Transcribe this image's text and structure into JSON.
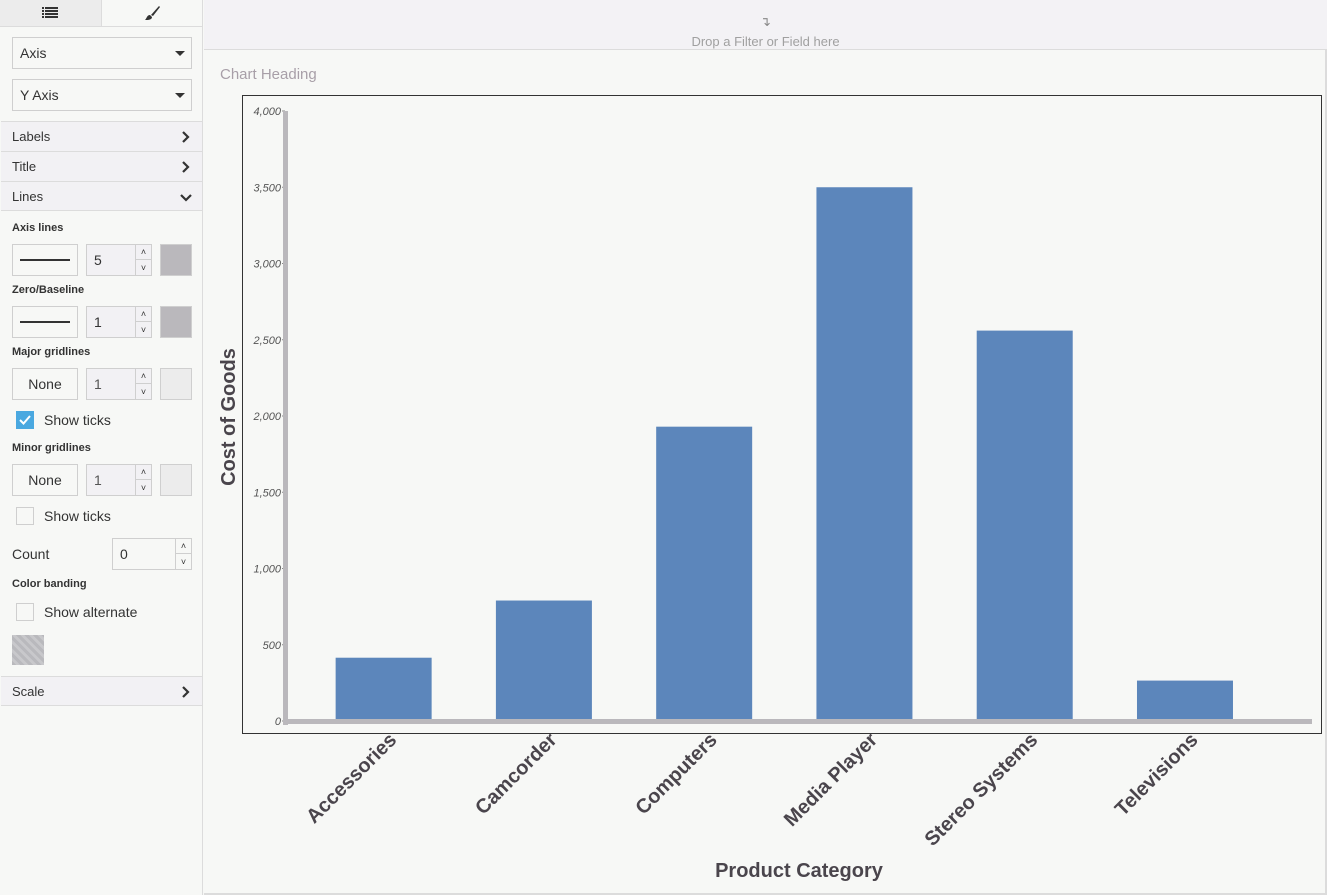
{
  "sidebar": {
    "tabs": [
      {
        "name": "fields",
        "icon": "list-icon"
      },
      {
        "name": "format",
        "icon": "paintbrush-icon",
        "active": true
      }
    ],
    "element_select": "Axis",
    "axis_select": "Y Axis",
    "sections": {
      "labels": "Labels",
      "title": "Title",
      "lines": "Lines",
      "scale": "Scale"
    },
    "lines": {
      "axis_lines": {
        "label": "Axis lines",
        "style": "solid",
        "width": "5",
        "color": "#bab8bc"
      },
      "zero_baseline": {
        "label": "Zero/Baseline",
        "style": "solid",
        "width": "1",
        "color": "#bab8bc"
      },
      "major_gridlines": {
        "label": "Major gridlines",
        "style": "None",
        "width": "1",
        "color": "#ececec",
        "show_ticks_label": "Show ticks",
        "show_ticks": true
      },
      "minor_gridlines": {
        "label": "Minor gridlines",
        "style": "None",
        "width": "1",
        "color": "#ececec",
        "show_ticks_label": "Show ticks",
        "show_ticks": false
      },
      "count": {
        "label": "Count",
        "value": "0"
      },
      "color_banding": {
        "label": "Color banding",
        "show_alternate_label": "Show alternate",
        "show_alternate": false
      }
    }
  },
  "dropzone": {
    "icon": "drop-arrow-icon",
    "text": "Drop a Filter or Field here"
  },
  "chart_heading": "Chart Heading",
  "colors": {
    "bar": "#5c86bb",
    "axis_line": "#bab8bc",
    "frame": "#333333"
  },
  "chart_data": {
    "type": "bar",
    "title": "Chart Heading",
    "xlabel": "Product Category",
    "ylabel": "Cost of Goods",
    "categories": [
      "Accessories",
      "Camcorder",
      "Computers",
      "Media Player",
      "Stereo Systems",
      "Televisions"
    ],
    "values": [
      415,
      790,
      1930,
      3500,
      2560,
      265
    ],
    "ylim": [
      0,
      4000
    ],
    "yticks": [
      0,
      500,
      1000,
      1500,
      2000,
      2500,
      3000,
      3500,
      4000
    ],
    "ytick_labels": [
      "0",
      "500",
      "1,000",
      "1,500",
      "2,000",
      "2,500",
      "3,000",
      "3,500",
      "4,000"
    ],
    "grid": false,
    "legend": "none"
  }
}
